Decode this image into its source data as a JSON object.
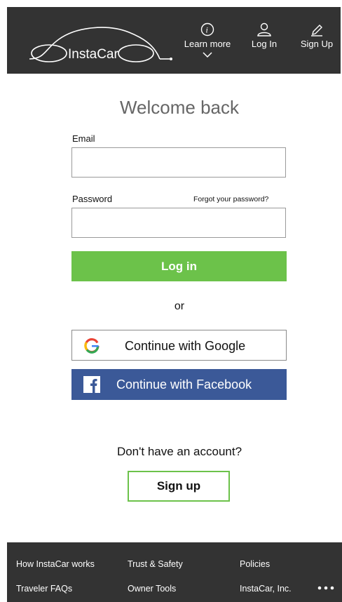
{
  "header": {
    "brand": "InstaCar",
    "nav": {
      "learn_more": "Learn more",
      "log_in": "Log In",
      "sign_up": "Sign Up"
    }
  },
  "form": {
    "title": "Welcome back",
    "email_label": "Email",
    "email_value": "",
    "password_label": "Password",
    "password_value": "",
    "forgot_link": "Forgot your password?",
    "login_button": "Log in",
    "or_text": "or",
    "google_button": "Continue with Google",
    "facebook_button": "Continue with Facebook",
    "no_account_text": "Don't have an account?",
    "signup_button": "Sign up"
  },
  "footer": {
    "links": [
      "How InstaCar works",
      "Trust & Safety",
      "Policies",
      "Traveler FAQs",
      "Owner Tools",
      "InstaCar, Inc."
    ]
  },
  "icons": {
    "info": "info-icon",
    "user": "user-icon",
    "pencil": "pencil-icon",
    "chevron": "chevron-down-icon",
    "google": "google-icon",
    "facebook": "facebook-icon",
    "more": "more-icon"
  },
  "colors": {
    "header_bg": "#333333",
    "accent_green": "#6cc24a",
    "facebook_blue": "#3b5998"
  }
}
